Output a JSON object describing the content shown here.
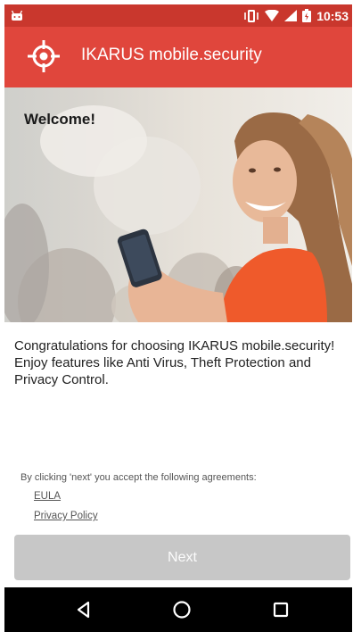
{
  "status_bar": {
    "time": "10:53",
    "icons": [
      "android-notification-icon",
      "vibrate-icon",
      "wifi-icon",
      "signal-icon",
      "battery-icon"
    ]
  },
  "app_bar": {
    "title": "IKARUS mobile.security",
    "logo_icon": "crosshair-icon",
    "color": "#e0463c"
  },
  "hero": {
    "heading": "Welcome!"
  },
  "intro_text": "Congratulations for choosing IKARUS mobile.security! Enjoy features like Anti Virus, Theft Protection and Privacy Control.",
  "agreements": {
    "label": "By clicking 'next' you accept the following agreements:",
    "links": [
      {
        "label": "EULA"
      },
      {
        "label": "Privacy Policy"
      }
    ]
  },
  "next_button": {
    "label": "Next",
    "enabled": false
  },
  "nav_bar": {
    "icons": [
      "back-icon",
      "home-icon",
      "recents-icon"
    ]
  }
}
